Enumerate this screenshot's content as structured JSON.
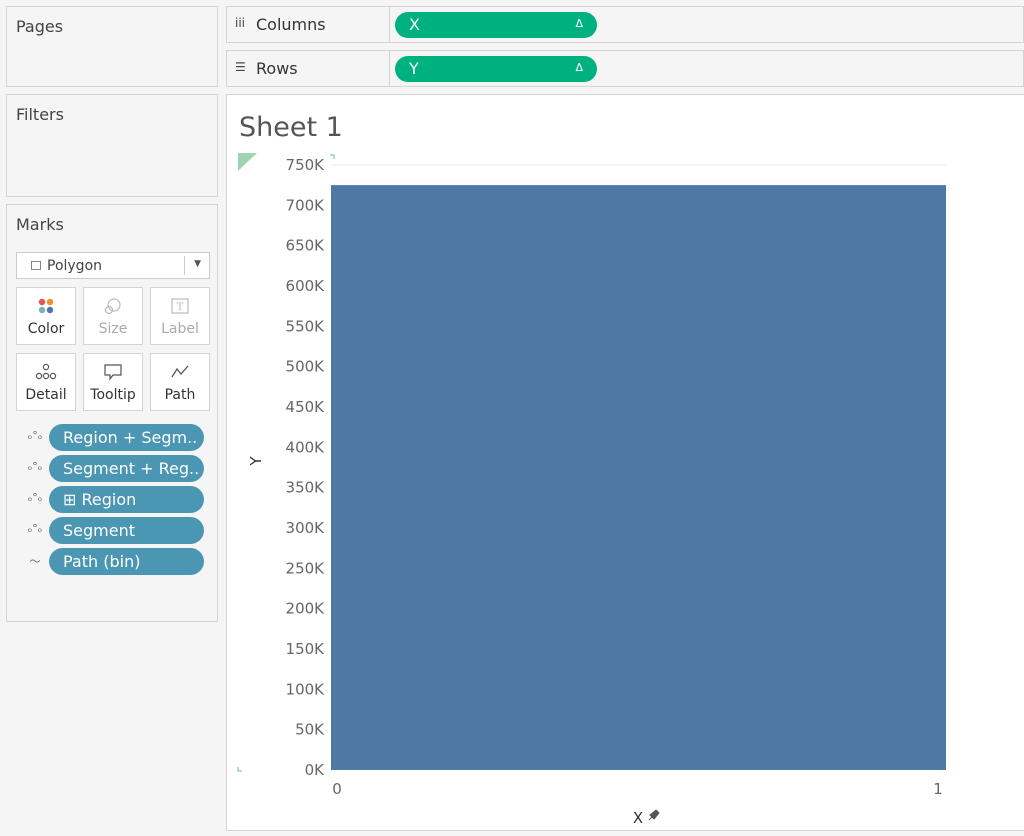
{
  "cards": {
    "pages_title": "Pages",
    "filters_title": "Filters",
    "marks_title": "Marks"
  },
  "marks": {
    "mark_type": "Polygon",
    "buttons": [
      {
        "label": "Color",
        "icon": "color-icon"
      },
      {
        "label": "Size",
        "icon": "size-icon"
      },
      {
        "label": "Label",
        "icon": "label-icon"
      },
      {
        "label": "Detail",
        "icon": "detail-icon"
      },
      {
        "label": "Tooltip",
        "icon": "tooltip-icon"
      },
      {
        "label": "Path",
        "icon": "path-icon"
      }
    ],
    "pills": [
      {
        "label": "Region + Segm..",
        "icon": "detail-icon"
      },
      {
        "label": "Segment + Reg..",
        "icon": "detail-icon"
      },
      {
        "label": "⊞ Region",
        "icon": "detail-icon"
      },
      {
        "label": "Segment",
        "icon": "detail-icon"
      },
      {
        "label": "Path (bin)",
        "icon": "path-icon"
      }
    ]
  },
  "shelves": {
    "columns_label": "Columns",
    "columns_pill": "X",
    "rows_label": "Rows",
    "rows_pill": "Y",
    "delta_symbol": "Δ"
  },
  "sheet": {
    "title": "Sheet 1"
  },
  "colors": {
    "mark_fill": "#4e79a7",
    "green_pill": "#00b180",
    "blue_pill": "#4b96b3"
  },
  "chart_data": {
    "type": "area",
    "title": "",
    "xlabel": "X",
    "ylabel": "Y",
    "xlim": [
      0,
      1
    ],
    "ylim": [
      0,
      750000
    ],
    "x_ticks": [
      "0",
      "1"
    ],
    "y_ticks": [
      "0K",
      "50K",
      "100K",
      "150K",
      "200K",
      "250K",
      "300K",
      "350K",
      "400K",
      "450K",
      "500K",
      "550K",
      "600K",
      "650K",
      "700K",
      "750K"
    ],
    "y_tick_values": [
      0,
      50000,
      100000,
      150000,
      200000,
      250000,
      300000,
      350000,
      400000,
      450000,
      500000,
      550000,
      600000,
      650000,
      700000,
      750000
    ],
    "series": [
      {
        "x": [
          0,
          1
        ],
        "values": [
          725000,
          725000
        ]
      }
    ],
    "grid": false
  }
}
